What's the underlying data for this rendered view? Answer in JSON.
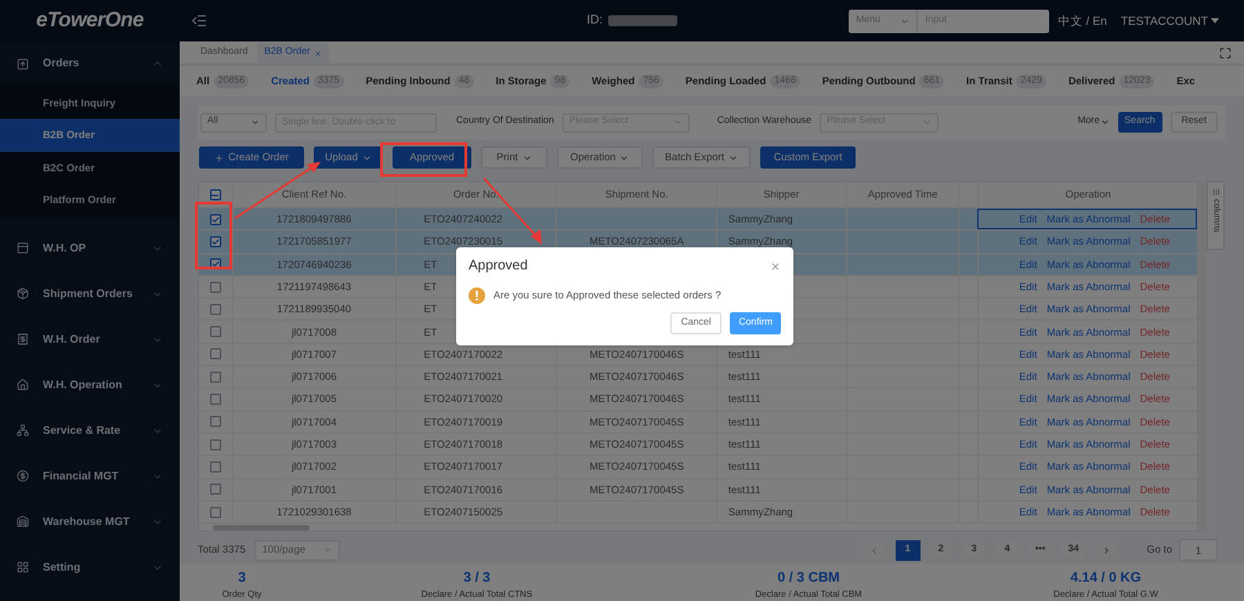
{
  "header": {
    "logo": "eTowerOne",
    "id_label": "ID:",
    "menu_select": "Menu",
    "search_placeholder": "Input",
    "language": "中文 / En",
    "account": "TESTACCOUNT"
  },
  "sidebar": {
    "items": [
      {
        "label": "Orders",
        "expanded": true,
        "children": [
          {
            "label": "Freight Inquiry",
            "selected": false
          },
          {
            "label": "B2B Order",
            "selected": true
          },
          {
            "label": "B2C Order",
            "selected": false
          },
          {
            "label": "Platform Order",
            "selected": false
          }
        ]
      },
      {
        "label": "W.H. OP",
        "expanded": false
      },
      {
        "label": "Shipment Orders",
        "expanded": false
      },
      {
        "label": "W.H. Order",
        "expanded": false
      },
      {
        "label": "W.H. Operation",
        "expanded": false
      },
      {
        "label": "Service & Rate",
        "expanded": false
      },
      {
        "label": "Financial MGT",
        "expanded": false
      },
      {
        "label": "Warehouse MGT",
        "expanded": false
      },
      {
        "label": "Setting",
        "expanded": false
      }
    ]
  },
  "page_tabs": [
    {
      "label": "Dashboard",
      "selected": false,
      "closable": false
    },
    {
      "label": "B2B Order",
      "selected": true,
      "closable": true
    }
  ],
  "status_tabs": [
    {
      "label": "All",
      "count": "20856",
      "selected": false
    },
    {
      "label": "Created",
      "count": "3375",
      "selected": true
    },
    {
      "label": "Pending Inbound",
      "count": "48",
      "selected": false
    },
    {
      "label": "In Storage",
      "count": "98",
      "selected": false
    },
    {
      "label": "Weighed",
      "count": "756",
      "selected": false
    },
    {
      "label": "Pending Loaded",
      "count": "1466",
      "selected": false
    },
    {
      "label": "Pending Outbound",
      "count": "661",
      "selected": false
    },
    {
      "label": "In Transit",
      "count": "2429",
      "selected": false
    },
    {
      "label": "Delivered",
      "count": "12023",
      "selected": false
    },
    {
      "label": "Exc",
      "selected": false
    }
  ],
  "filters": {
    "type_select": "All",
    "ref_placeholder": "Single line. Double-click to",
    "country_label": "Country Of Destination",
    "country_placeholder": "Please Select",
    "warehouse_label": "Collection Warehouse",
    "warehouse_placeholder": "Please Select",
    "more": "More",
    "search": "Search",
    "reset": "Reset"
  },
  "actions": [
    {
      "label": "Create Order",
      "kind": "create"
    },
    {
      "label": "Upload",
      "kind": "primary-dropdown"
    },
    {
      "label": "Approved",
      "kind": "primary"
    },
    {
      "label": "Print",
      "kind": "dropdown"
    },
    {
      "label": "Operation",
      "kind": "dropdown"
    },
    {
      "label": "Batch Export",
      "kind": "dropdown"
    },
    {
      "label": "Custom Export",
      "kind": "primary"
    }
  ],
  "table": {
    "select_all_indeterminate": true,
    "columns": [
      "Client Ref No.",
      "Order No.",
      "Shipment No.",
      "Shipper",
      "Approved Time",
      "Operation"
    ],
    "side_panel": "columns",
    "rows": [
      {
        "client_ref": "1721809497886",
        "order_no": "ETO2407240022",
        "shipper": "SammyZhang",
        "selected": true,
        "focused": true,
        "edit": "Edit",
        "mark": "Mark as Abnormal",
        "delete": "Delete"
      },
      {
        "client_ref": "1721705851977",
        "order_no": "ETO2407230015",
        "shipment_no": "METO2407230065A",
        "shipper": "SammyZhang",
        "selected": true,
        "focused": false,
        "edit": "Edit",
        "mark": "Mark as Abnormal",
        "delete": "Delete"
      },
      {
        "client_ref": "1720746940236",
        "order_no": "ET",
        "selected": true,
        "focused": false,
        "edit": "Edit",
        "mark": "Mark as Abnormal",
        "delete": "Delete"
      },
      {
        "client_ref": "1721197498643",
        "order_no": "ET",
        "selected": false,
        "focused": false,
        "edit": "Edit",
        "mark": "Mark as Abnormal",
        "delete": "Delete"
      },
      {
        "client_ref": "1721189935040",
        "order_no": "ET",
        "selected": false,
        "focused": false,
        "edit": "Edit",
        "mark": "Mark as Abnormal",
        "delete": "Delete"
      },
      {
        "client_ref": "jl0717008",
        "order_no": "ET",
        "selected": false,
        "focused": false,
        "edit": "Edit",
        "mark": "Mark as Abnormal",
        "delete": "Delete"
      },
      {
        "client_ref": "jl0717007",
        "order_no": "ETO2407170022",
        "shipment_no": "METO2407170046S",
        "shipper": "test111",
        "selected": false,
        "focused": false,
        "edit": "Edit",
        "mark": "Mark as Abnormal",
        "delete": "Delete"
      },
      {
        "client_ref": "jl0717006",
        "order_no": "ETO2407170021",
        "shipment_no": "METO2407170046S",
        "shipper": "test111",
        "selected": false,
        "focused": false,
        "edit": "Edit",
        "mark": "Mark as Abnormal",
        "delete": "Delete"
      },
      {
        "client_ref": "jl0717005",
        "order_no": "ETO2407170020",
        "shipment_no": "METO2407170046S",
        "shipper": "test111",
        "selected": false,
        "focused": false,
        "edit": "Edit",
        "mark": "Mark as Abnormal",
        "delete": "Delete"
      },
      {
        "client_ref": "jl0717004",
        "order_no": "ETO2407170019",
        "shipment_no": "METO2407170045S",
        "shipper": "test111",
        "selected": false,
        "focused": false,
        "edit": "Edit",
        "mark": "Mark as Abnormal",
        "delete": "Delete"
      },
      {
        "client_ref": "jl0717003",
        "order_no": "ETO2407170018",
        "shipment_no": "METO2407170045S",
        "shipper": "test111",
        "selected": false,
        "focused": false,
        "edit": "Edit",
        "mark": "Mark as Abnormal",
        "delete": "Delete"
      },
      {
        "client_ref": "jl0717002",
        "order_no": "ETO2407170017",
        "shipment_no": "METO2407170045S",
        "shipper": "test111",
        "selected": false,
        "focused": false,
        "edit": "Edit",
        "mark": "Mark as Abnormal",
        "delete": "Delete"
      },
      {
        "client_ref": "jl0717001",
        "order_no": "ETO2407170016",
        "shipment_no": "METO2407170045S",
        "shipper": "test111",
        "selected": false,
        "focused": false,
        "edit": "Edit",
        "mark": "Mark as Abnormal",
        "delete": "Delete"
      },
      {
        "client_ref": "1721029301638",
        "order_no": "ETO2407150025",
        "shipper": "SammyZhang",
        "selected": false,
        "focused": false,
        "edit": "Edit",
        "mark": "Mark as Abnormal",
        "delete": "Delete"
      }
    ]
  },
  "pagination": {
    "total": "Total 3375",
    "page_size": "100/page",
    "pages": [
      {
        "label": "1",
        "selected": true
      },
      {
        "label": "2",
        "selected": false
      },
      {
        "label": "3",
        "selected": false
      },
      {
        "label": "4",
        "selected": false
      },
      {
        "label": "•••",
        "selected": false
      },
      {
        "label": "34",
        "selected": false
      }
    ],
    "goto_label": "Go to",
    "goto_value": "1"
  },
  "summary": [
    {
      "value": "3",
      "label": "Order Qty"
    },
    {
      "value": "3 / 3",
      "label": "Declare / Actual Total CTNS"
    },
    {
      "value": "0 / 3 CBM",
      "label": "Declare / Actual Total CBM"
    },
    {
      "value": "4.14 / 0 KG",
      "label": "Declare / Actual Total G.W"
    }
  ],
  "dialog": {
    "title": "Approved",
    "message": "Are you sure to Approved these selected orders ?",
    "cancel": "Cancel",
    "confirm": "Confirm"
  }
}
